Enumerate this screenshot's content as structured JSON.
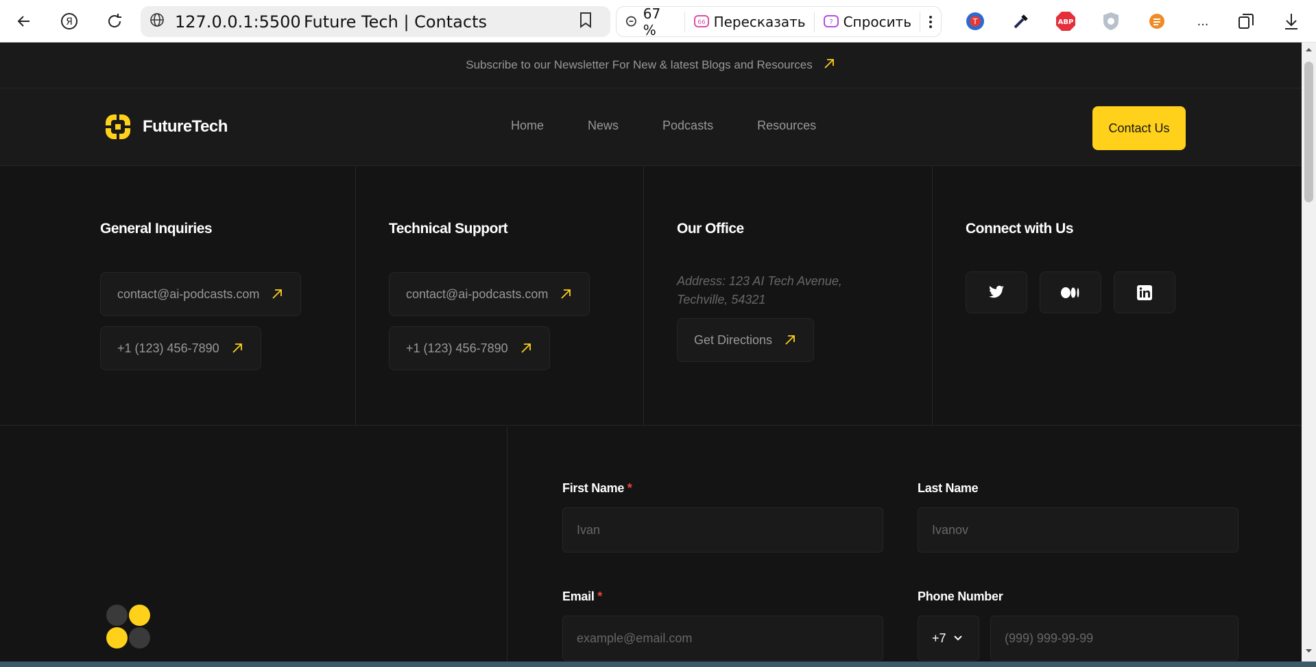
{
  "browser": {
    "url": "127.0.0.1:5500",
    "tab_title": "Future Tech | Contacts",
    "zoom": "67 %",
    "retell_label": "Пересказать",
    "ask_label": "Спросить",
    "more_label": "...",
    "abp_label": "ABP"
  },
  "page": {
    "newsletter_text": "Subscribe to our Newsletter For New & latest Blogs and Resources",
    "logo_text": "FutureTech",
    "nav": [
      "Home",
      "News",
      "Podcasts",
      "Resources"
    ],
    "contact_button": "Contact Us",
    "accent_color": "#ffd11a"
  },
  "sections": {
    "general": {
      "title": "General Inquiries",
      "email": "contact@ai-podcasts.com",
      "phone": "+1 (123) 456-7890"
    },
    "support": {
      "title": "Technical Support",
      "email": "contact@ai-podcasts.com",
      "phone": "+1 (123) 456-7890"
    },
    "office": {
      "title": "Our Office",
      "address": "Address: 123 AI Tech Avenue, Techville, 54321",
      "directions": "Get Directions"
    },
    "connect": {
      "title": "Connect with Us",
      "icons": [
        "twitter-icon",
        "medium-icon",
        "linkedin-icon"
      ]
    }
  },
  "form": {
    "first_name_label": "First Name",
    "first_name_placeholder": "Ivan",
    "last_name_label": "Last Name",
    "last_name_placeholder": "Ivanov",
    "email_label": "Email",
    "email_placeholder": "example@email.com",
    "phone_label": "Phone Number",
    "phone_code": "+7",
    "phone_placeholder": "(999) 999-99-99",
    "required_mark": "*"
  }
}
